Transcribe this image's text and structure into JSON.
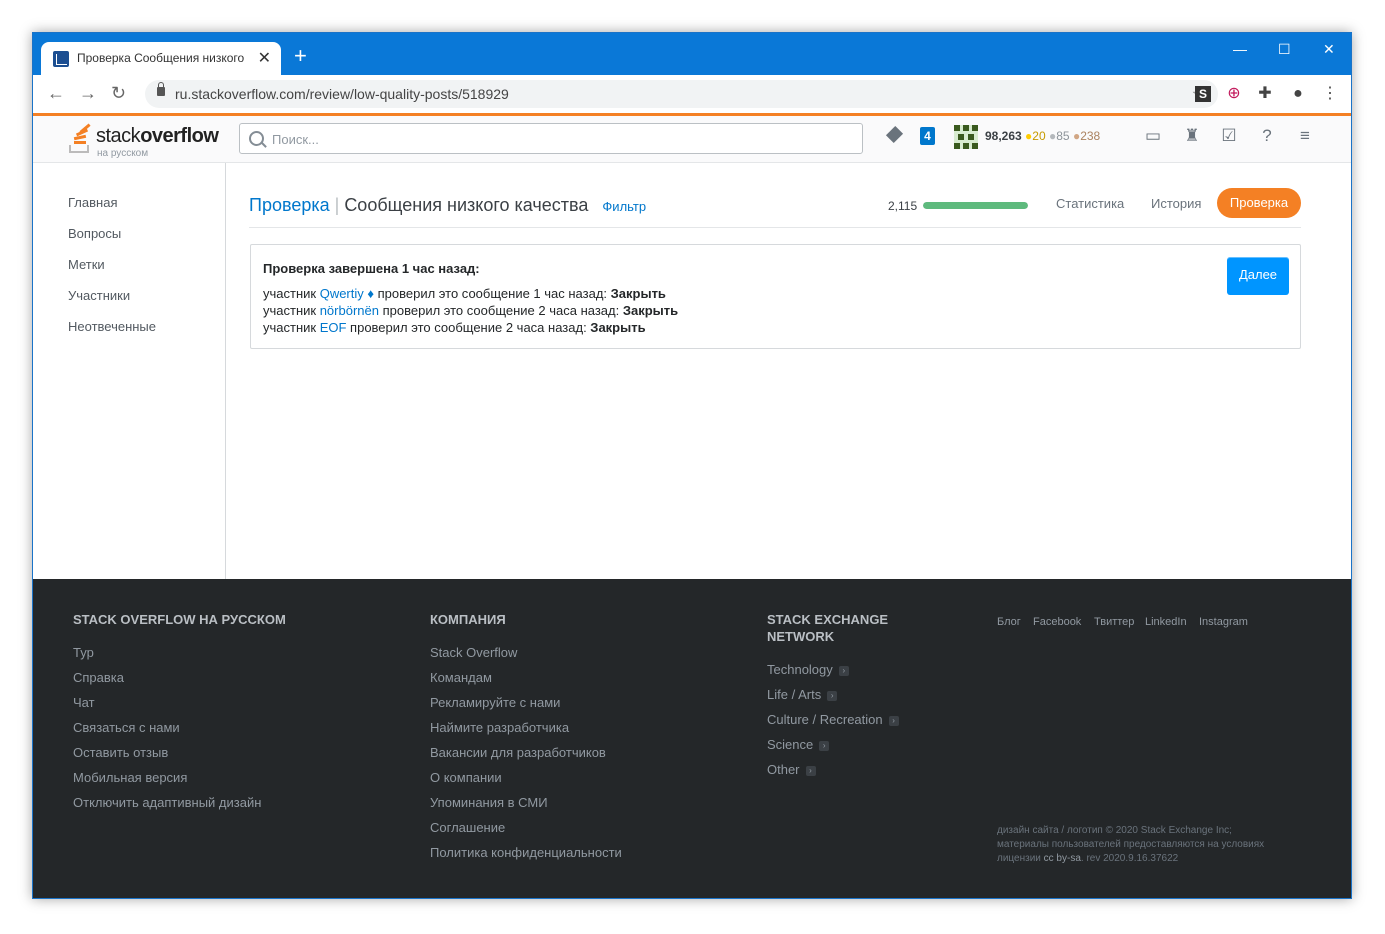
{
  "browser": {
    "tab_title": "Проверка Сообщения низкого",
    "url": "ru.stackoverflow.com/review/low-quality-posts/518929"
  },
  "topbar": {
    "logo_word_light": "stack",
    "logo_word_bold": "overflow",
    "logo_sub": "на русском",
    "search_placeholder": "Поиск...",
    "inbox_count": "4",
    "reputation": "98,263",
    "gold": "20",
    "silver": "85",
    "bronze": "238"
  },
  "leftnav": [
    "Главная",
    "Вопросы",
    "Метки",
    "Участники",
    "Неотвеченные"
  ],
  "review": {
    "breadcrumb_root": "Проверка",
    "queue_title": "Сообщения низкого качества",
    "filter_label": "Фильтр",
    "count": "2,115",
    "progress": 1.0,
    "tabs": [
      "Статистика",
      "История"
    ],
    "active_tab": "Проверка",
    "completed_heading": "Проверка завершена 1 час назад:",
    "entries": [
      {
        "prefix": "участник ",
        "user": "Qwertiy ♦",
        "mid": " проверил это сообщение 1 час назад: ",
        "action": "Закрыть"
      },
      {
        "prefix": "участник ",
        "user": "nörbörnën",
        "mid": " проверил это сообщение 2 часа назад: ",
        "action": "Закрыть"
      },
      {
        "prefix": "участник ",
        "user": "EOF",
        "mid": " проверил это сообщение 2 часа назад: ",
        "action": "Закрыть"
      }
    ],
    "next_button": "Далее"
  },
  "footer": {
    "col1": {
      "heading": "STACK OVERFLOW НА РУССКОМ",
      "links": [
        "Тур",
        "Справка",
        "Чат",
        "Связаться с нами",
        "Оставить отзыв",
        "Мобильная версия",
        "Отключить адаптивный дизайн"
      ]
    },
    "col2": {
      "heading": "КОМПАНИЯ",
      "links": [
        "Stack Overflow",
        "Командам",
        "Рекламируйте с нами",
        "Наймите разработчика",
        "Вакансии для разработчиков",
        "О компании",
        "Упоминания в СМИ",
        "Соглашение",
        "Политика конфиденциальности"
      ]
    },
    "col3": {
      "heading": "STACK EXCHANGE\nNETWORK",
      "links": [
        "Technology",
        "Life / Arts",
        "Culture / Recreation",
        "Science",
        "Other"
      ]
    },
    "social": [
      "Блог",
      "Facebook",
      "Твиттер",
      "LinkedIn",
      "Instagram"
    ],
    "copyright_1": "дизайн сайта / логотип © 2020 Stack Exchange Inc;",
    "copyright_2": "материалы пользователей предоставляются на условиях",
    "copyright_3a": "лицензии ",
    "copyright_3b": "cc by-sa",
    "copyright_3c": ". rev 2020.9.16.37622"
  }
}
